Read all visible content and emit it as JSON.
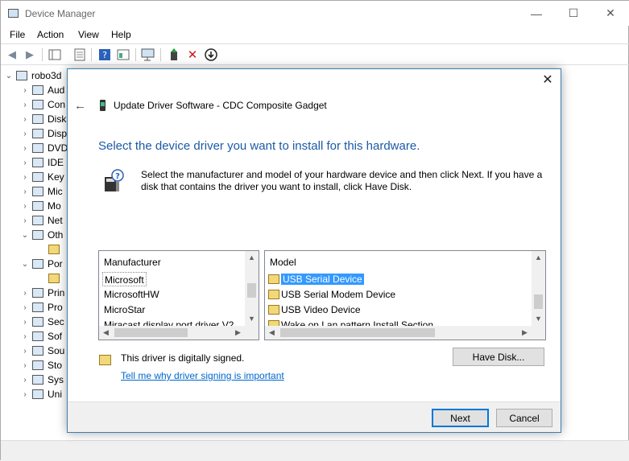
{
  "device_manager": {
    "title": "Device Manager",
    "window_controls": {
      "minimize": "—",
      "maximize": "☐",
      "close": "✕"
    },
    "menu": [
      "File",
      "Action",
      "View",
      "Help"
    ],
    "tree": {
      "root": "robo3d",
      "items": [
        {
          "label": "Aud",
          "expander": "›"
        },
        {
          "label": "Con",
          "expander": "›"
        },
        {
          "label": "Disk",
          "expander": "›"
        },
        {
          "label": "Disp",
          "expander": "›"
        },
        {
          "label": "DVD",
          "expander": "›"
        },
        {
          "label": "IDE",
          "expander": "›"
        },
        {
          "label": "Key",
          "expander": "›"
        },
        {
          "label": "Mic",
          "expander": "›"
        },
        {
          "label": "Mo",
          "expander": "›"
        },
        {
          "label": "Net",
          "expander": "›"
        },
        {
          "label": "Oth",
          "expander": "⌄"
        },
        {
          "label": "",
          "expander": ""
        },
        {
          "label": "Por",
          "expander": "⌄"
        },
        {
          "label": "",
          "expander": ""
        },
        {
          "label": "Prin",
          "expander": "›"
        },
        {
          "label": "Pro",
          "expander": "›"
        },
        {
          "label": "Sec",
          "expander": "›"
        },
        {
          "label": "Sof",
          "expander": "›"
        },
        {
          "label": "Sou",
          "expander": "›"
        },
        {
          "label": "Sto",
          "expander": "›"
        },
        {
          "label": "Sys",
          "expander": "›"
        },
        {
          "label": "Uni",
          "expander": "›"
        }
      ]
    }
  },
  "dialog": {
    "close": "✕",
    "back": "←",
    "caption": "Update Driver Software - CDC Composite Gadget",
    "heading": "Select the device driver you want to install for this hardware.",
    "description": "Select the manufacturer and model of your hardware device and then click Next. If you have a disk that contains the driver you want to install, click Have Disk.",
    "manufacturer": {
      "header": "Manufacturer",
      "items": [
        "Microsoft",
        "MicrosoftHW",
        "MicroStar",
        "Miracast display port driver V2"
      ],
      "selected": "Microsoft"
    },
    "model": {
      "header": "Model",
      "items": [
        "USB Serial Device",
        "USB Serial Modem Device",
        "USB Video Device",
        "Wake on Lan pattern Install Section"
      ],
      "selected": "USB Serial Device"
    },
    "signed_text": "This driver is digitally signed.",
    "signing_link": "Tell me why driver signing is important",
    "have_disk": "Have Disk...",
    "next": "Next",
    "cancel": "Cancel"
  },
  "colors": {
    "heading": "#1c5aa6",
    "selection": "#3399ff",
    "link": "#0066cc",
    "dialog_border": "#3c7fb1"
  }
}
